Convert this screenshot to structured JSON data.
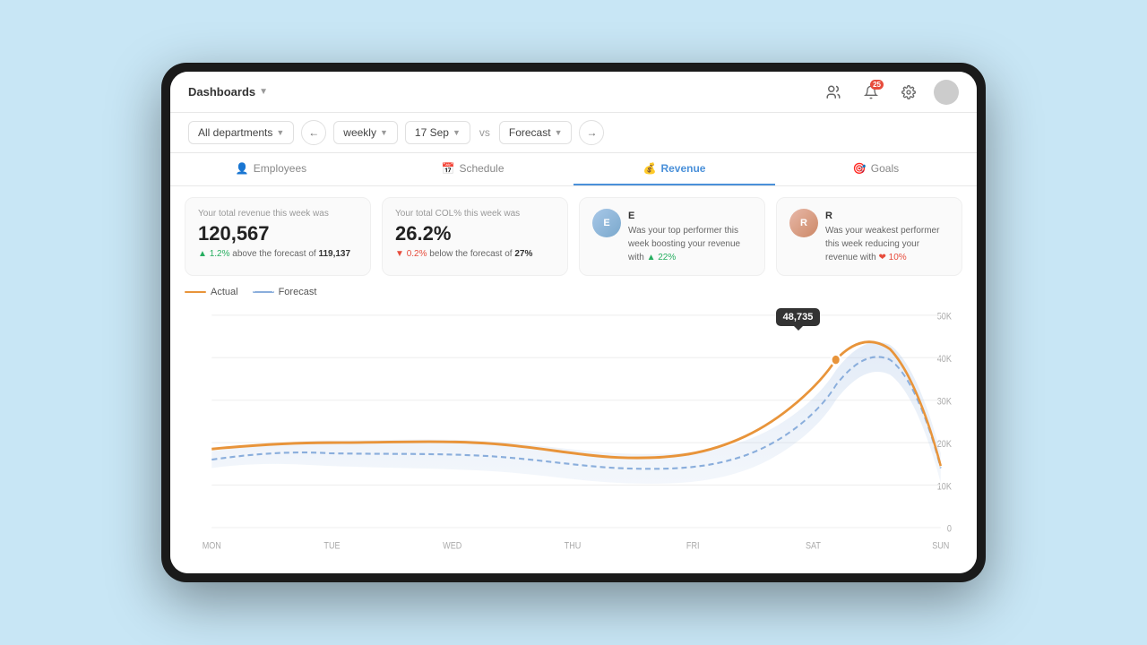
{
  "header": {
    "title": "Dashboards",
    "chevron": "▼",
    "notif_count": "25",
    "icons": {
      "people": "👥",
      "bell": "🔔",
      "gear": "⚙"
    }
  },
  "toolbar": {
    "department": "All departments",
    "period": "weekly",
    "date": "17 Sep",
    "vs_label": "vs",
    "compare": "Forecast"
  },
  "tabs": [
    {
      "id": "employees",
      "label": "Employees",
      "icon": "👤",
      "active": false
    },
    {
      "id": "schedule",
      "label": "Schedule",
      "icon": "📅",
      "active": false
    },
    {
      "id": "revenue",
      "label": "Revenue",
      "icon": "💰",
      "active": true
    },
    {
      "id": "goals",
      "label": "Goals",
      "icon": "🎯",
      "active": false
    }
  ],
  "stats": {
    "revenue": {
      "label": "Your total revenue this week was",
      "value": "120,567",
      "trend_pct": "1.2%",
      "trend_dir": "up",
      "trend_label": "above the forecast of",
      "forecast": "119,137"
    },
    "col": {
      "label": "Your total COL% this week was",
      "value": "26.2%",
      "trend_pct": "0.2%",
      "trend_dir": "down",
      "trend_label": "below the forecast of",
      "forecast": "27%"
    },
    "top_performer": {
      "label": "Was your top performer this week boosting your revenue with",
      "initial": "E",
      "trend": "22%",
      "trend_dir": "up"
    },
    "weak_performer": {
      "label": "Was your weakest performer this week reducing your revenue with",
      "initial": "R",
      "trend": "10%",
      "trend_dir": "down"
    }
  },
  "chart": {
    "legend": {
      "actual": "Actual",
      "forecast": "Forecast"
    },
    "tooltip": {
      "value": "48,735",
      "day": "SAT"
    },
    "y_axis": [
      "50K",
      "40K",
      "30K",
      "20K",
      "10K",
      "0"
    ],
    "x_axis": [
      "MON",
      "TUE",
      "WED",
      "THU",
      "FRI",
      "SAT",
      "SUN"
    ]
  }
}
